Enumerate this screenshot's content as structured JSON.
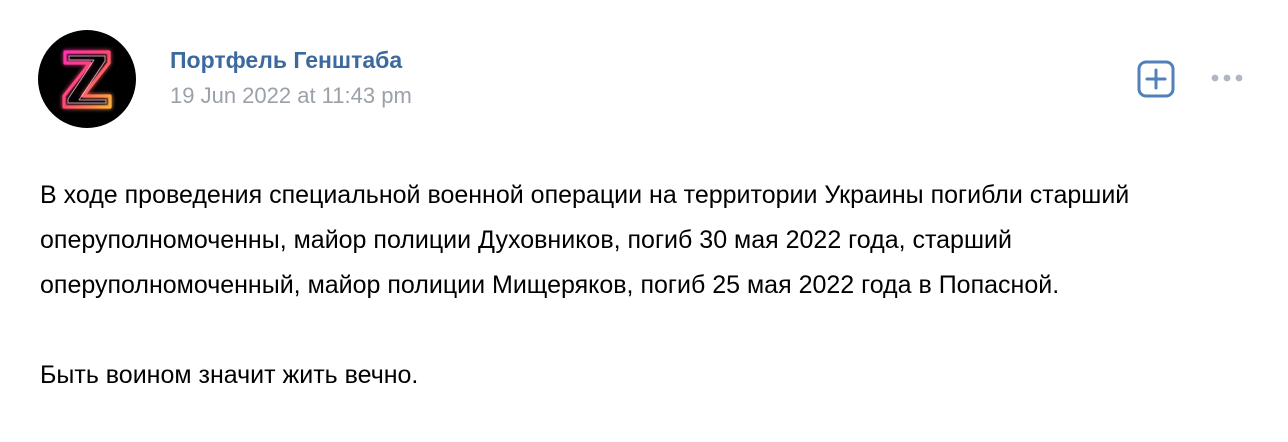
{
  "post": {
    "author": "Портфель Генштаба",
    "date": "19 Jun 2022 at 11:43 pm",
    "avatar_icon": "neon-z-logo",
    "subscribe_icon": "plus-square-icon",
    "more_icon": "more-dots-icon",
    "paragraphs": [
      "В ходе проведения специальной военной операции на территории Украины погибли старший оперуполномоченны, майор полиции Духовников, погиб 30 мая 2022 года, старший оперуполномоченный, майор полиции Мищеряков, погиб 25 мая 2022 года в Попасной.",
      "Быть воином значит жить вечно."
    ]
  },
  "colors": {
    "author": "#3d6a9e",
    "date": "#9aa1a9",
    "text": "#000000",
    "accent_icon": "#5181b8",
    "more_dots": "#aeb7c2"
  }
}
